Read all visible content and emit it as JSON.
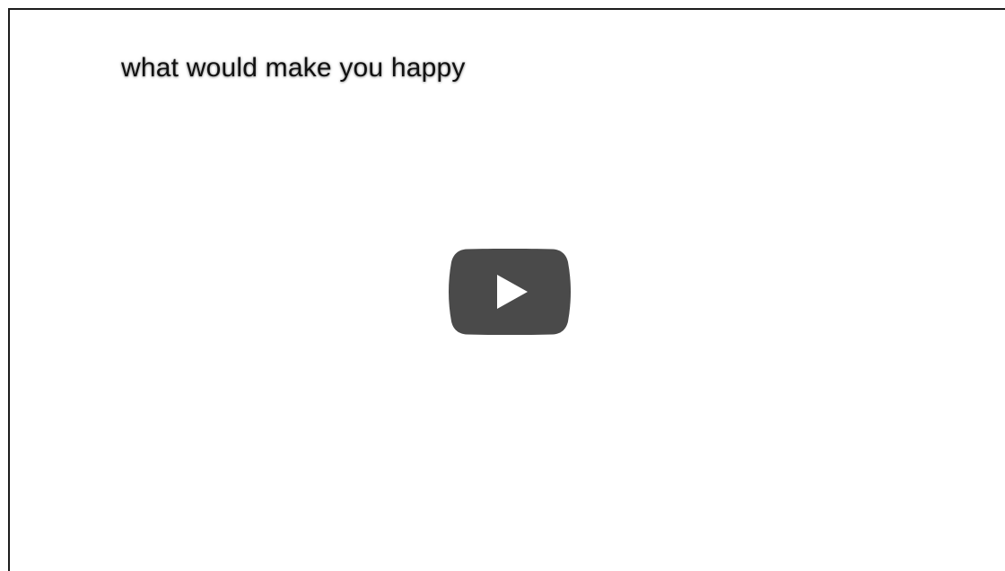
{
  "video": {
    "title": "what would make you happy",
    "play_button_color": "#4a4a4a",
    "play_icon_color": "#ffffff",
    "frame_border_color": "#1c1c1c",
    "background_color": "#ffffff"
  },
  "icons": {
    "play": "play-icon"
  }
}
